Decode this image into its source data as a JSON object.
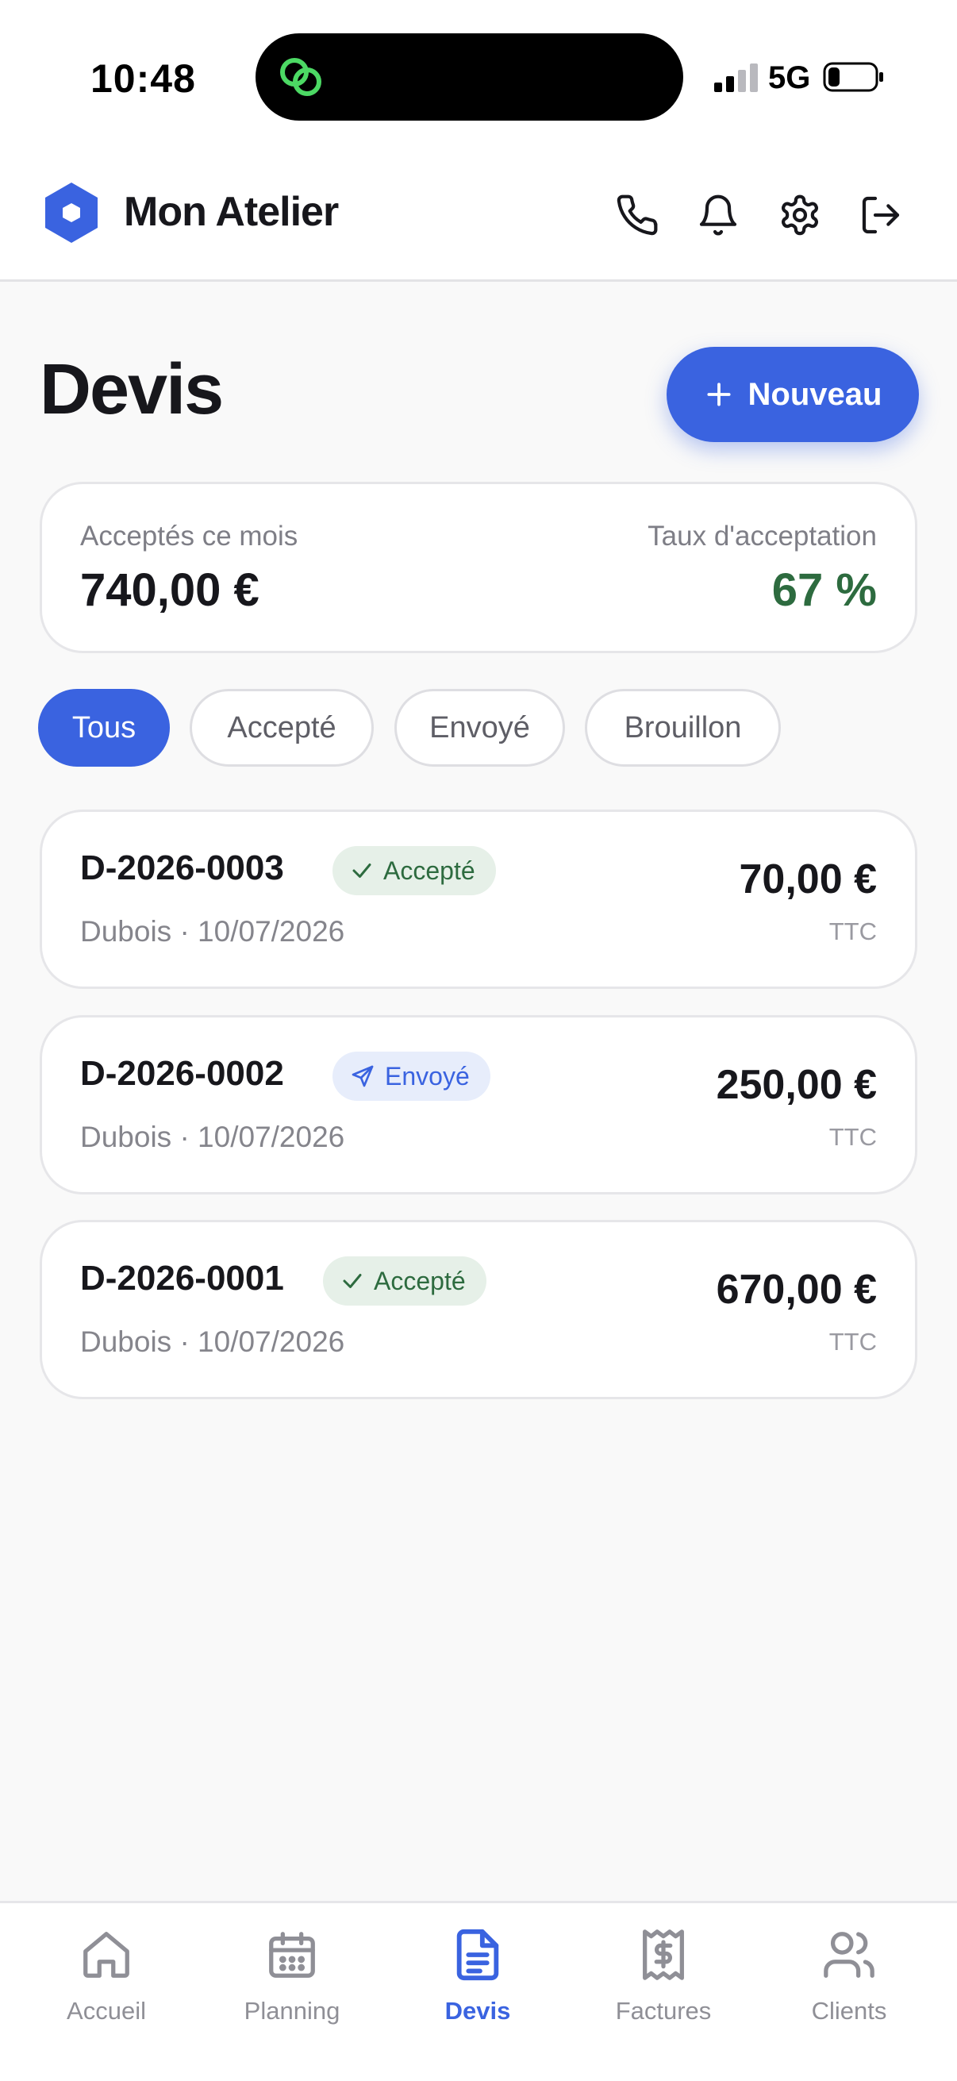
{
  "status_bar": {
    "time": "10:48",
    "network": "5G",
    "icons": [
      "link-icon",
      "signal-icon",
      "battery-icon"
    ]
  },
  "header": {
    "app_name": "Mon Atelier",
    "icons": [
      "hexagon-logo-icon",
      "phone-icon",
      "bell-icon",
      "gear-icon",
      "logout-icon"
    ]
  },
  "page": {
    "title": "Devis",
    "new_button": "Nouveau"
  },
  "summary": {
    "accepted_label": "Acceptés ce mois",
    "accepted_value": "740,00 €",
    "rate_label": "Taux d'acceptation",
    "rate_value": "67 %"
  },
  "filters": [
    {
      "label": "Tous",
      "active": true
    },
    {
      "label": "Accepté",
      "active": false
    },
    {
      "label": "Envoyé",
      "active": false
    },
    {
      "label": "Brouillon",
      "active": false
    }
  ],
  "quotes": [
    {
      "number": "D-2026-0003",
      "status": "Accepté",
      "status_icon": "check-icon",
      "meta": "Dubois · 10/07/2026",
      "amount": "70,00 €",
      "tax": "TTC"
    },
    {
      "number": "D-2026-0002",
      "status": "Envoyé",
      "status_icon": "send-icon",
      "meta": "Dubois · 10/07/2026",
      "amount": "250,00 €",
      "tax": "TTC"
    },
    {
      "number": "D-2026-0001",
      "status": "Accepté",
      "status_icon": "check-icon",
      "meta": "Dubois · 10/07/2026",
      "amount": "670,00 €",
      "tax": "TTC"
    }
  ],
  "nav": [
    {
      "label": "Accueil",
      "icon": "home-icon",
      "active": false
    },
    {
      "label": "Planning",
      "icon": "calendar-icon",
      "active": false
    },
    {
      "label": "Devis",
      "icon": "document-icon",
      "active": true
    },
    {
      "label": "Factures",
      "icon": "receipt-icon",
      "active": false
    },
    {
      "label": "Clients",
      "icon": "users-icon",
      "active": false
    }
  ],
  "colors": {
    "accent": "#3a63e0",
    "success": "#2d6b3f",
    "success_bg": "#e6f0e8",
    "sent_bg": "#e7edfb",
    "text": "#17171c",
    "muted": "#85858c"
  }
}
